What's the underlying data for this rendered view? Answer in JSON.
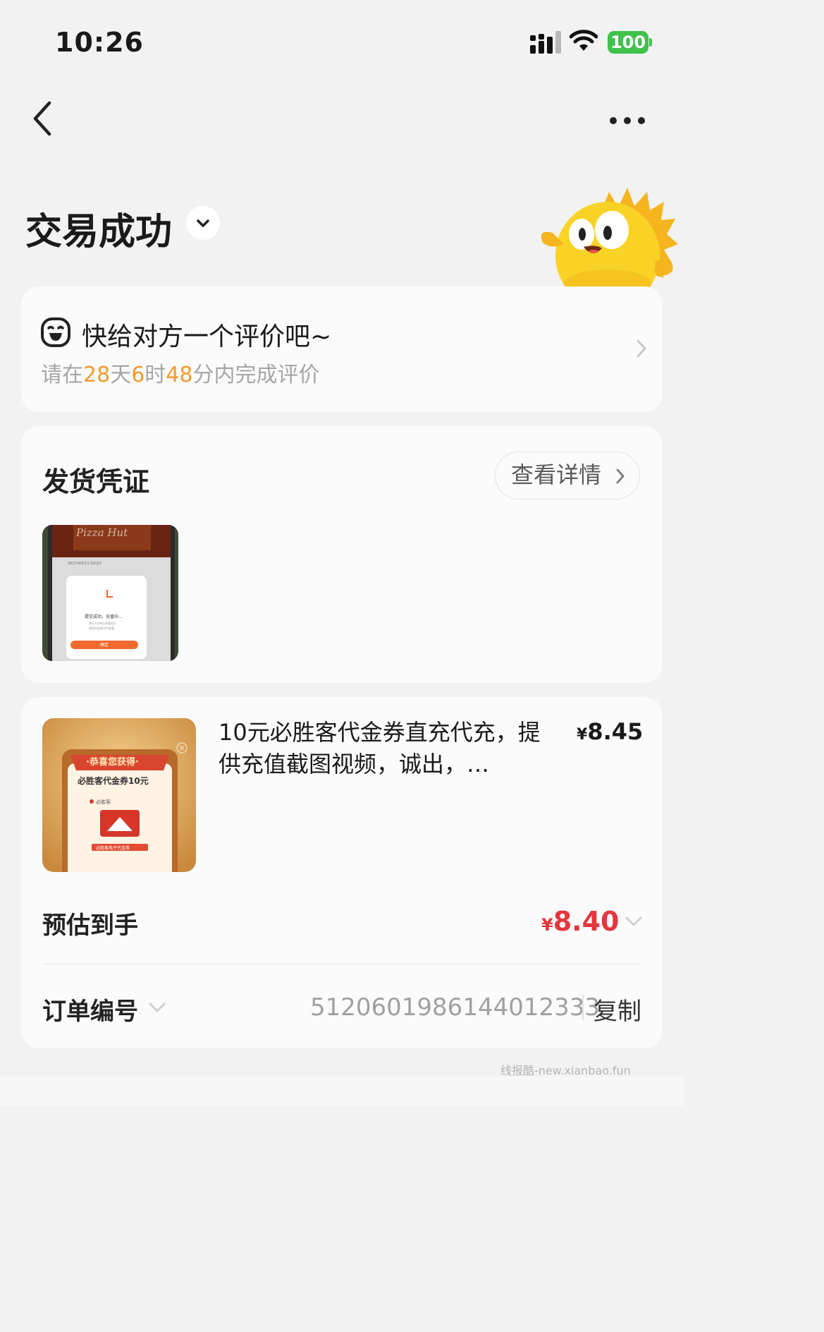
{
  "status_bar": {
    "time": "10:26",
    "battery": "100"
  },
  "header": {
    "title": "交易成功"
  },
  "review": {
    "title": "快给对方一个评价吧~",
    "sub_prefix": "请在",
    "days": "28",
    "days_unit": "天",
    "hours": "6",
    "hours_unit": "时",
    "minutes": "48",
    "sub_suffix": "分内完成评价"
  },
  "proof": {
    "title": "发货凭证",
    "detail_label": "查看详情"
  },
  "product": {
    "title": "10元必胜客代金券直充代充，提供充值截图视频，诚出，…",
    "currency": "¥",
    "price": "8.45"
  },
  "estimate": {
    "label": "预估到手",
    "currency": "¥",
    "value": "8.40"
  },
  "order": {
    "number_label": "订单编号",
    "number": "5120601986144012333",
    "copy_label": "复制"
  },
  "proof_image": {
    "brand": "Pizza Hut",
    "top_line": "2017/4/6/11:32/2/1",
    "status": "提交成功，充值中...",
    "note_1": "预计1分钟后充值成功",
    "note_2": "请到对应账号中查看",
    "confirm": "确定"
  },
  "product_image": {
    "banner": "·恭喜您获得·",
    "headline": "必胜客代金券10元",
    "brand": "必胜客",
    "caption": "必胜客电子代金券"
  },
  "watermark": "线报酷-new.xianbao.fun"
}
